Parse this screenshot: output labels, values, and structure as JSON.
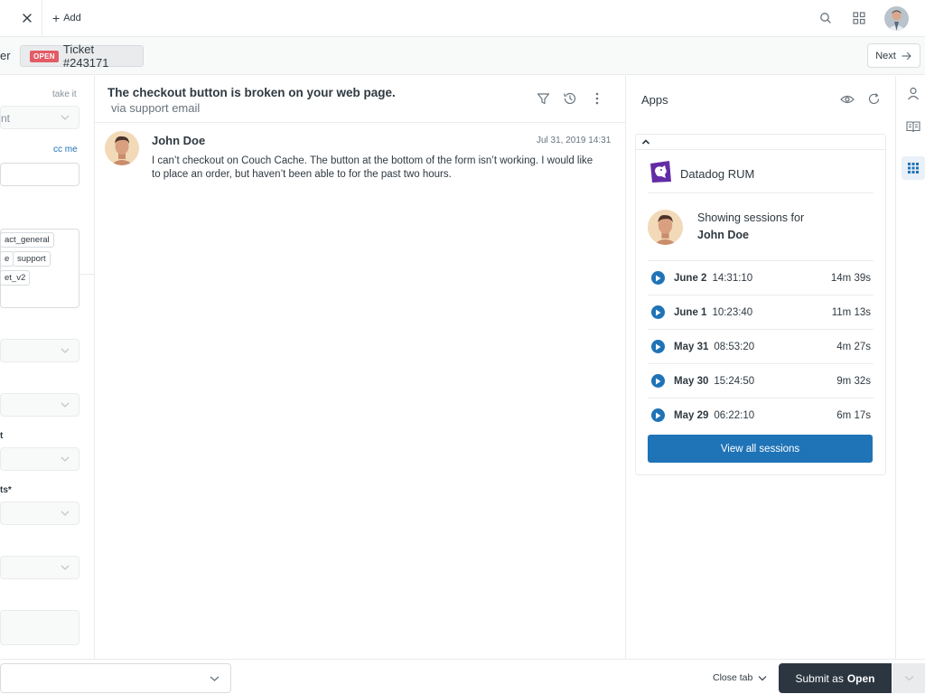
{
  "topbar": {
    "add_label": "Add"
  },
  "tabstrip": {
    "prev_tab_fragment": "er",
    "status_badge": "OPEN",
    "ticket_label": "Ticket #243171",
    "next_label": "Next"
  },
  "left_panel": {
    "take_it": "take it",
    "requester_value_fragment": "nt",
    "cc_me": "cc me",
    "tags": [
      "act_general",
      "e",
      "support",
      "et_v2"
    ],
    "field_label_1": "t",
    "field_label_2": "ts*"
  },
  "conversation": {
    "title": "The checkout button is broken on your web page.",
    "subtitle": "via support email",
    "message": {
      "author": "John Doe",
      "time": "Jul 31, 2019 14:31",
      "body": "I can’t checkout on Couch Cache. The button at the bottom of the form isn’t working. I would like to place an order, but haven’t been able to for the past two hours."
    }
  },
  "apps": {
    "title": "Apps",
    "app_name": "Datadog RUM",
    "showing_label": "Showing sessions for",
    "user_name": "John Doe",
    "sessions": [
      {
        "date": "June 2",
        "time": "14:31:10",
        "duration": "14m 39s"
      },
      {
        "date": "June 1",
        "time": "10:23:40",
        "duration": "11m 13s"
      },
      {
        "date": "May 31",
        "time": "08:53:20",
        "duration": "4m 27s"
      },
      {
        "date": "May 30",
        "time": "15:24:50",
        "duration": "9m 32s"
      },
      {
        "date": "May 29",
        "time": "06:22:10",
        "duration": "6m 17s"
      }
    ],
    "view_all_label": "View all sessions"
  },
  "bottombar": {
    "close_tab_label": "Close tab",
    "submit_prefix": "Submit as",
    "submit_status": "Open"
  },
  "colors": {
    "accent": "#1f73b7",
    "status_open": "#e35b66",
    "submit_bg": "#2b3640",
    "datadog_purple": "#632ca6"
  },
  "icons": {
    "topbar": [
      "close-icon",
      "plus-icon",
      "search-icon",
      "apps-grid-icon",
      "avatar"
    ],
    "conversation": [
      "filter-icon",
      "history-icon",
      "more-vertical-icon"
    ],
    "apps": [
      "eye-icon",
      "refresh-icon",
      "chevron-up-icon",
      "datadog-logo-icon",
      "play-icon"
    ],
    "rail": [
      "user-icon",
      "book-icon",
      "apps-icon"
    ]
  }
}
